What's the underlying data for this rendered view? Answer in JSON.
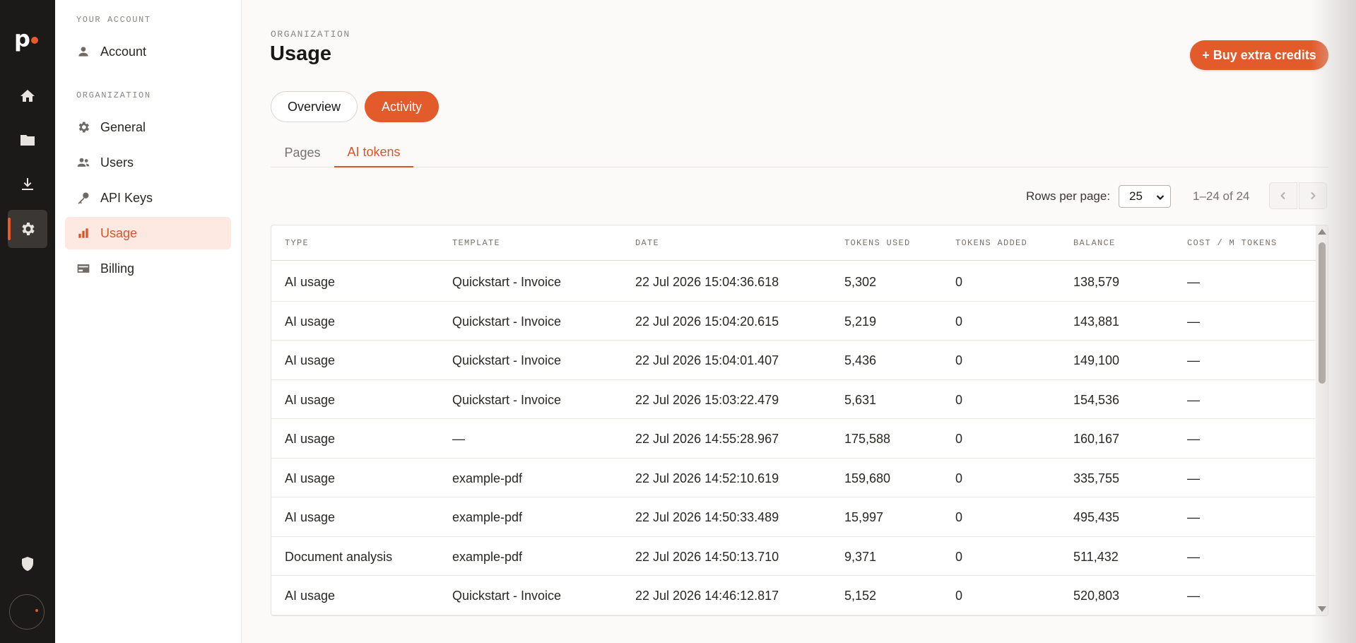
{
  "app": {
    "logo_letter": "p"
  },
  "nav": {
    "section_account": "YOUR ACCOUNT",
    "section_org": "ORGANIZATION",
    "items": [
      {
        "label": "Account",
        "icon": "person-icon"
      },
      {
        "label": "General",
        "icon": "gear-icon"
      },
      {
        "label": "Users",
        "icon": "users-icon"
      },
      {
        "label": "API Keys",
        "icon": "key-icon"
      },
      {
        "label": "Usage",
        "icon": "bar-chart-icon",
        "active": true
      },
      {
        "label": "Billing",
        "icon": "credit-card-icon"
      }
    ]
  },
  "header": {
    "eyebrow": "ORGANIZATION",
    "title": "Usage",
    "buy_label": "+ Buy extra credits"
  },
  "tabs": {
    "overview": "Overview",
    "activity": "Activity",
    "active": "Activity"
  },
  "subtabs": {
    "pages": "Pages",
    "ai_tokens": "AI tokens",
    "active": "AI tokens"
  },
  "pager": {
    "rows_label": "Rows per page:",
    "rows_value": "25",
    "range": "1–24 of 24"
  },
  "table": {
    "columns": [
      "TYPE",
      "TEMPLATE",
      "DATE",
      "TOKENS USED",
      "TOKENS ADDED",
      "BALANCE",
      "COST / M TOKENS"
    ],
    "rows": [
      [
        "AI usage",
        "Quickstart - Invoice",
        "22 Jul 2026 15:04:36.618",
        "5,302",
        "0",
        "138,579",
        "—"
      ],
      [
        "AI usage",
        "Quickstart - Invoice",
        "22 Jul 2026 15:04:20.615",
        "5,219",
        "0",
        "143,881",
        "—"
      ],
      [
        "AI usage",
        "Quickstart - Invoice",
        "22 Jul 2026 15:04:01.407",
        "5,436",
        "0",
        "149,100",
        "—"
      ],
      [
        "AI usage",
        "Quickstart - Invoice",
        "22 Jul 2026 15:03:22.479",
        "5,631",
        "0",
        "154,536",
        "—"
      ],
      [
        "AI usage",
        "—",
        "22 Jul 2026 14:55:28.967",
        "175,588",
        "0",
        "160,167",
        "—"
      ],
      [
        "AI usage",
        "example-pdf",
        "22 Jul 2026 14:52:10.619",
        "159,680",
        "0",
        "335,755",
        "—"
      ],
      [
        "AI usage",
        "example-pdf",
        "22 Jul 2026 14:50:33.489",
        "15,997",
        "0",
        "495,435",
        "—"
      ],
      [
        "Document analysis",
        "example-pdf",
        "22 Jul 2026 14:50:13.710",
        "9,371",
        "0",
        "511,432",
        "—"
      ],
      [
        "AI usage",
        "Quickstart - Invoice",
        "22 Jul 2026 14:46:12.817",
        "5,152",
        "0",
        "520,803",
        "—"
      ]
    ]
  },
  "colors": {
    "accent": "#e35a2b",
    "rail_bg": "#1c1a18",
    "active_nav_bg": "#fde9e2"
  }
}
